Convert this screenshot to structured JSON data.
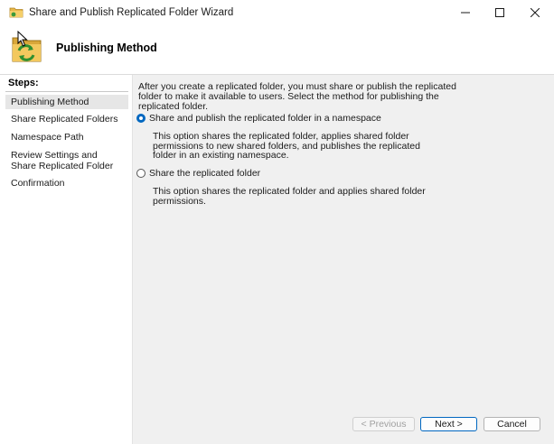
{
  "window": {
    "title": "Share and Publish Replicated Folder Wizard"
  },
  "header": {
    "heading": "Publishing Method"
  },
  "steps": {
    "title": "Steps:",
    "items": [
      {
        "label": "Publishing Method",
        "active": true
      },
      {
        "label": "Share Replicated Folders",
        "active": false
      },
      {
        "label": "Namespace Path",
        "active": false
      },
      {
        "label": "Review Settings and Share Replicated Folder",
        "active": false
      },
      {
        "label": "Confirmation",
        "active": false
      }
    ]
  },
  "content": {
    "intro": "After you create a replicated folder, you must share or publish the replicated folder to make it available to users. Select the method for publishing the replicated folder.",
    "options": [
      {
        "label": "Share and publish the replicated folder in a namespace",
        "selected": true,
        "description": "This option shares the replicated folder, applies shared folder permissions to new shared folders, and publishes the replicated folder in an existing namespace."
      },
      {
        "label": "Share the replicated folder",
        "selected": false,
        "description": "This option shares the replicated folder and applies shared folder permissions."
      }
    ]
  },
  "footer": {
    "previous_label": "< Previous",
    "next_label": "Next >",
    "cancel_label": "Cancel"
  },
  "colors": {
    "accent": "#0067c0",
    "content_bg": "#f0f0f0",
    "active_step_bg": "#e6e6e6"
  }
}
